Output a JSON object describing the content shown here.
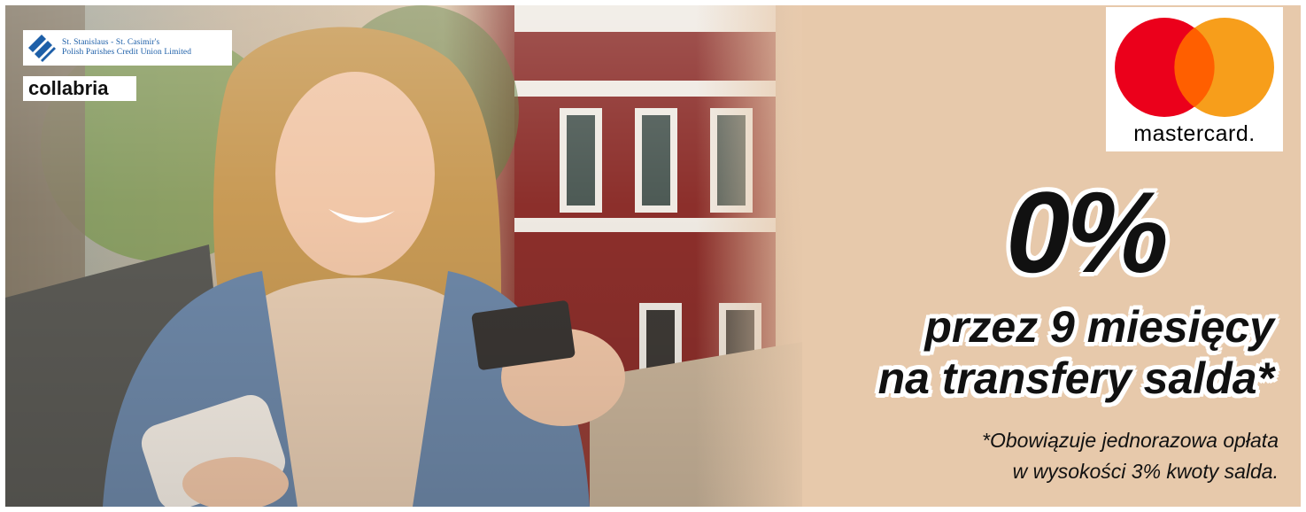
{
  "credit_union": {
    "line1": "St. Stanislaus - St. Casimir's",
    "line2": "Polish Parishes Credit Union Limited"
  },
  "partner": {
    "name": "collabria"
  },
  "card_brand": {
    "name": "mastercard.",
    "colors": {
      "red": "#eb001b",
      "orange": "#f79e1b",
      "overlap": "#ff5f00"
    }
  },
  "promo": {
    "rate": "0%",
    "line1": "przez 9 miesięcy",
    "line2": "na transfery salda*"
  },
  "disclaimer": {
    "line1": "*Obowiązuje jednorazowa opłata",
    "line2": "w wysokości 3% kwoty salda."
  },
  "colors": {
    "background": "#e7c9ab",
    "text": "#111111",
    "brand_blue": "#1d5fa8"
  }
}
